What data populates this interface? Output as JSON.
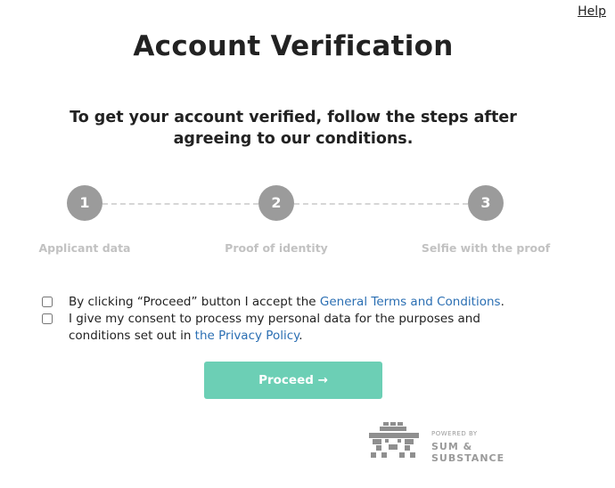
{
  "header": {
    "help_label": "Help"
  },
  "main": {
    "title": "Account Verification",
    "subtitle": "To get your account verified, follow the steps after agreeing to our conditions."
  },
  "steps": [
    {
      "number": "1",
      "label": "Applicant data"
    },
    {
      "number": "2",
      "label": "Proof of identity"
    },
    {
      "number": "3",
      "label": "Selfie with the proof"
    }
  ],
  "consents": {
    "terms": {
      "prefix": "By clicking “Proceed” button I accept the ",
      "link": "General Terms and Conditions",
      "suffix": ".",
      "checked": false
    },
    "privacy": {
      "prefix": "I give my consent to process my personal data for the purposes and conditions set out in ",
      "link": "the Privacy Policy",
      "suffix": ".",
      "checked": false
    }
  },
  "actions": {
    "proceed_label": "Proceed →"
  },
  "footer": {
    "powered_by": "POWERED BY",
    "company": "SUM & SUBSTANCE"
  },
  "colors": {
    "primary_button": "#6ccfb5",
    "link": "#2b6fb3",
    "step_circle": "#9b9b9b",
    "step_label": "#c2c2c2"
  }
}
